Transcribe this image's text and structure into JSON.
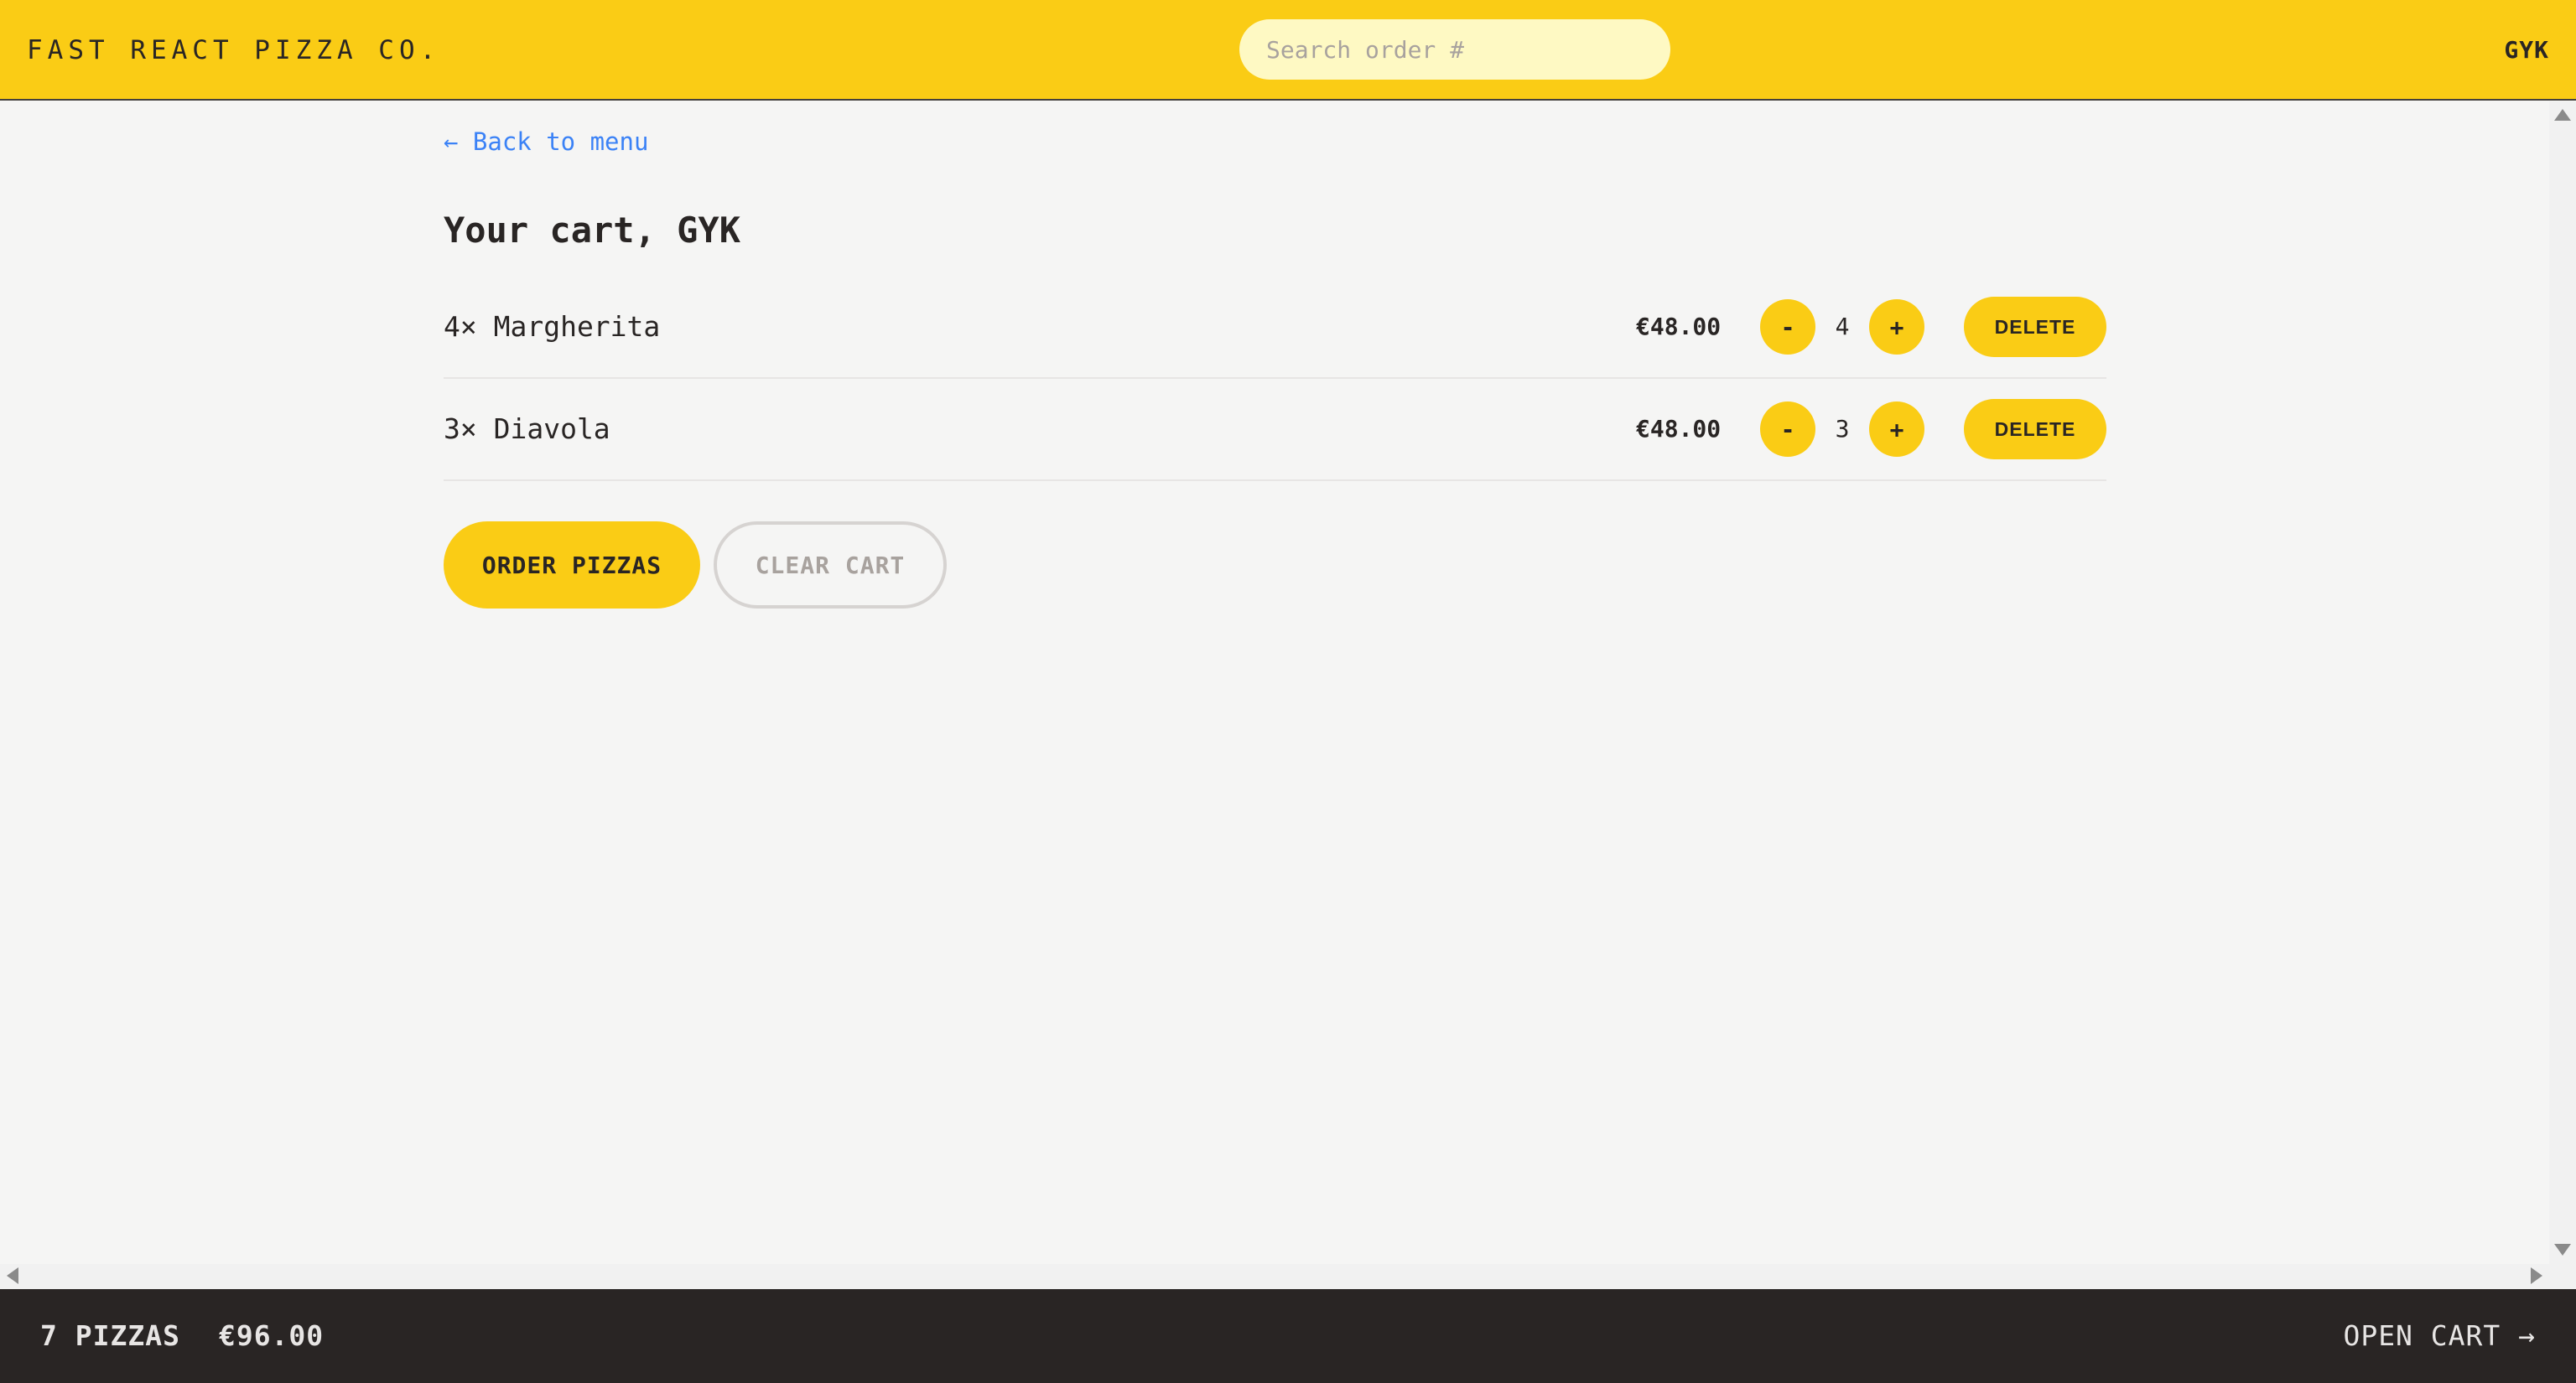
{
  "header": {
    "logo": "FAST REACT PIZZA CO.",
    "search_placeholder": "Search order #",
    "search_value": "",
    "username": "GYK"
  },
  "main": {
    "back_link": "← Back to menu",
    "title": "Your cart, GYK",
    "items": [
      {
        "name": "4× Margherita",
        "price": "€48.00",
        "quantity": "4",
        "minus_label": "-",
        "plus_label": "+",
        "delete_label": "DELETE"
      },
      {
        "name": "3× Diavola",
        "price": "€48.00",
        "quantity": "3",
        "minus_label": "-",
        "plus_label": "+",
        "delete_label": "DELETE"
      }
    ],
    "order_button": "ORDER PIZZAS",
    "clear_button": "CLEAR CART"
  },
  "footer": {
    "pizza_count": "7 PIZZAS",
    "total": "€96.00",
    "open_cart": "OPEN CART →"
  },
  "colors": {
    "brand_yellow": "#facc15",
    "search_bg": "#fef9c3",
    "footer_bg": "#292524",
    "link_blue": "#3b82f6",
    "page_bg": "#f5f5f4"
  }
}
